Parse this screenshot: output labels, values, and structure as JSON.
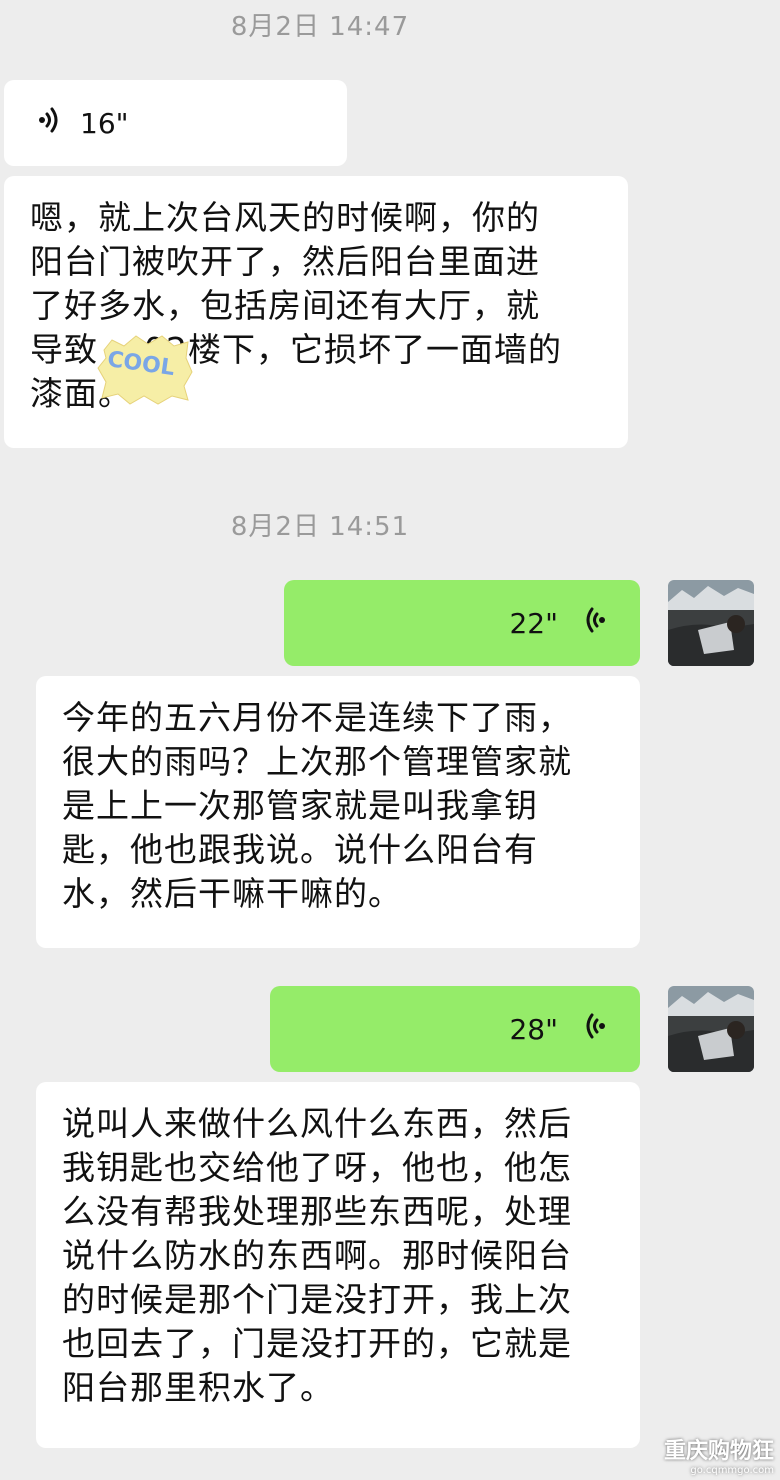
{
  "messages": {
    "ts1": "8月2日 14:47",
    "voice1_duration": "16\"",
    "text1": "嗯，就上次台风天的时候啊，你的\n阳台门被吹开了，然后阳台里面进\n了好多水，包括房间还有大厅，就\n导致    02楼下，它损坏了一面墙的\n漆面。",
    "ts2": "8月2日 14:51",
    "voice2_duration": "22\"",
    "text2": "今年的五六月份不是连续下了雨，\n很大的雨吗？上次那个管理管家就\n是上上一次那管家就是叫我拿钥\n匙，他也跟我说。说什么阳台有\n水，然后干嘛干嘛的。",
    "voice3_duration": "28\"",
    "text3": "说叫人来做什么风什么东西，然后\n我钥匙也交给他了呀，他也，他怎\n么没有帮我处理那些东西呢，处理\n说什么防水的东西啊。那时候阳台\n的时候是那个门是没打开，我上次\n也回去了，门是没打开的，它就是\n阳台那里积水了。"
  },
  "sticker_text": "COOL",
  "watermark": {
    "main": "重庆购物狂",
    "sub": "go.cqmmgo.com"
  },
  "colors": {
    "background": "#ededed",
    "incoming_bubble": "#ffffff",
    "outgoing_bubble": "#95ec69",
    "timestamp": "#9a9a9a"
  },
  "icons": {
    "voice_in": "voice-wave-icon",
    "voice_out": "voice-wave-icon",
    "avatar": "user-avatar"
  }
}
